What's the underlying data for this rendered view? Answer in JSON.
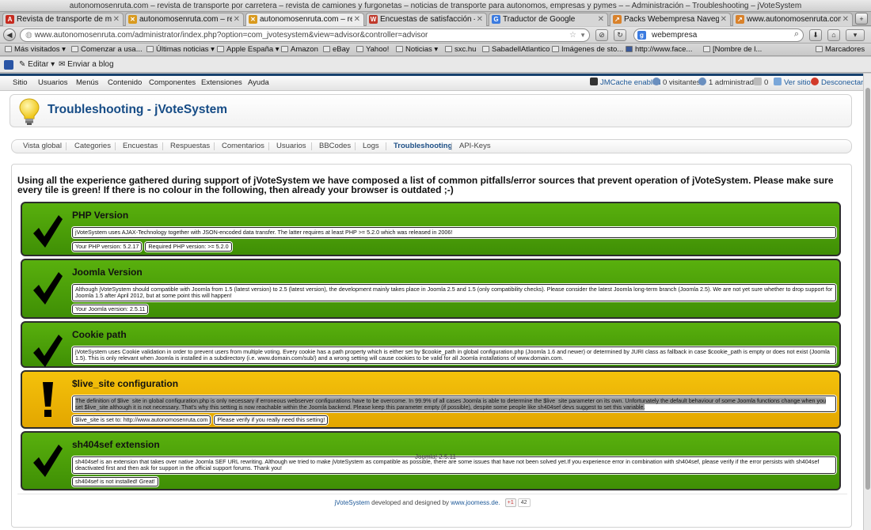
{
  "window": {
    "title": "autonomosenruta.com – revista de transporte por carretera – revista de camiones y furgonetas – noticias de transporte para autonomos, empresas y pymes – – Administración – Troubleshooting – jVoteSystem"
  },
  "browser": {
    "tabs": [
      {
        "label": "Revista de transporte de mer...",
        "icon": "A",
        "color": "#c62b1f"
      },
      {
        "label": "autonomosenruta.com – revi...",
        "icon": "✕",
        "color": "#d99a1e"
      },
      {
        "label": "autonomosenruta.com – revi...",
        "icon": "✕",
        "color": "#d99a1e"
      },
      {
        "label": "Encuestas de satisfacción – S...",
        "icon": "W",
        "color": "#c0392b"
      },
      {
        "label": "Traductor de Google",
        "icon": "G",
        "color": "#3b7be0"
      },
      {
        "label": "Packs Webempresa Navegad...",
        "icon": "↗",
        "color": "#d9822b"
      },
      {
        "label": "www.autonomosenruta.com",
        "icon": "↗",
        "color": "#d9822b"
      }
    ],
    "url": "www.autonomosenruta.com/administrator/index.php?option=com_jvotesystem&view=advisor&controller=advisor",
    "search_value": "webempresa",
    "bookmarks": [
      "Más visitados ▾",
      "Comenzar a usa...",
      "Últimas noticias ▾",
      "Apple España ▾",
      "Amazon",
      "eBay",
      "Yahoo!",
      "Noticias ▾",
      "sxc.hu",
      "SabadellAtlantico",
      "Imágenes de sto...",
      "http://www.face...",
      "[Nombre de l...",
      "Marcadores"
    ],
    "ext_toolbar": {
      "edit": "Editar",
      "send": "Enviar a blog"
    }
  },
  "admin_menu": {
    "items": [
      "Sitio",
      "Usuarios",
      "Menús",
      "Contenido",
      "Componentes",
      "Extensiones",
      "Ayuda"
    ],
    "status": {
      "cache": "JMCache enabled",
      "visitors": "0 visitantes",
      "admins": "1 administrador",
      "messages": "0",
      "view_site": "Ver sitio",
      "logout": "Desconectar"
    }
  },
  "header": {
    "title": "Troubleshooting - jVoteSystem"
  },
  "subnav": {
    "tabs": [
      "Vista global",
      "Categories",
      "Encuestas",
      "Respuestas",
      "Comentarios",
      "Usuarios",
      "BBCodes",
      "Logs",
      "Troubleshooting",
      "API-Keys"
    ],
    "active": "Troubleshooting"
  },
  "intro": "Using all the experience gathered during support of jVoteSystem we have composed a list of common pitfalls/error sources that prevent operation of jVoteSystem. Please make sure every tile is green! If there is no colour in the following, then already your browser is outdated ;-)",
  "tiles": [
    {
      "status": "ok",
      "title": "PHP Version",
      "text": "jVoteSystem uses AJAX-Technology together with JSON-encoded data transfer. The latter requires at least PHP >= 5.2.0 which was released in 2006!",
      "pills": [
        "Your PHP version: 5.2.17",
        "Required PHP version: >= 5.2.0"
      ]
    },
    {
      "status": "ok",
      "title": "Joomla Version",
      "text": "Although jVoteSystem should compatible with Joomla from 1.5 (latest version) to 2.5 (latest version), the development mainly takes place in Joomla 2.5 and 1.5 (only compatibility checks). Please consider the latest Joomla long-term branch (Joomla 2.5). We are not yet sure whether to drop support for Joomla 1.5 after April 2012, but at some point this will happen!",
      "pills": [
        "Your Joomla version: 2.5.11"
      ]
    },
    {
      "status": "ok",
      "title": "Cookie path",
      "text": "jVoteSystem uses Cookie validation in order to prevent users from multiple voting. Every cookie has a path property which is either set by $cookie_path in global configuration.php (Joomla 1.6 and newer) or determined by JURI class as fallback in case $cookie_path is empty or does not exist (Joomla 1.5). This is only relevant when Joomla is installed in a subdirectory (i.e. www.domain.com/sub/) and a wrong setting will cause cookies to be valid for all Joomla installations of www.domain.com.",
      "pills": []
    },
    {
      "status": "warn",
      "title": "$live_site configuration",
      "text": "The definition of $live_site in global configuration.php is only necessary if erroneous webserver configurations have to be overcome. In 99.9% of all cases Joomla is able to determine the $live_site parameter on its own. Unfortunately the default behaviour of some Joomla functions change when you set $live_site although it is not necessary. That's why this setting is now reachable within the Joomla backend. Please keep this parameter empty (if possible), despite some people like sh404sef devs suggest to set this variable.",
      "pills": [
        "$live_site is set to: http://www.autonomosenruta.com",
        "Please verify if you really need this setting!"
      ]
    },
    {
      "status": "ok",
      "title": "sh404sef extension",
      "text": "sh404sef is an extension that takes over native Joomla SEF URL rewriting. Although we tried to make jVoteSystem as compatible as possible, there are some issues that have not been solved yet.If you experience error in combination with sh404sef, please verify if the error persists with sh404sef deactivated first and then ask for support in the official support forums. Thank you!",
      "pills": [
        "sh404sef is not installed! Great!"
      ]
    }
  ],
  "footer": {
    "product": "jVoteSystem",
    "middle": " developed and designed by ",
    "site": "www.joomess.de.",
    "gplus": "+1",
    "count": "42"
  },
  "version": "Joomla! 2.5.11",
  "colors": {
    "ok": "#4ea10a",
    "warn": "#f0b800",
    "title": "#164c86",
    "link": "#1b5797"
  }
}
